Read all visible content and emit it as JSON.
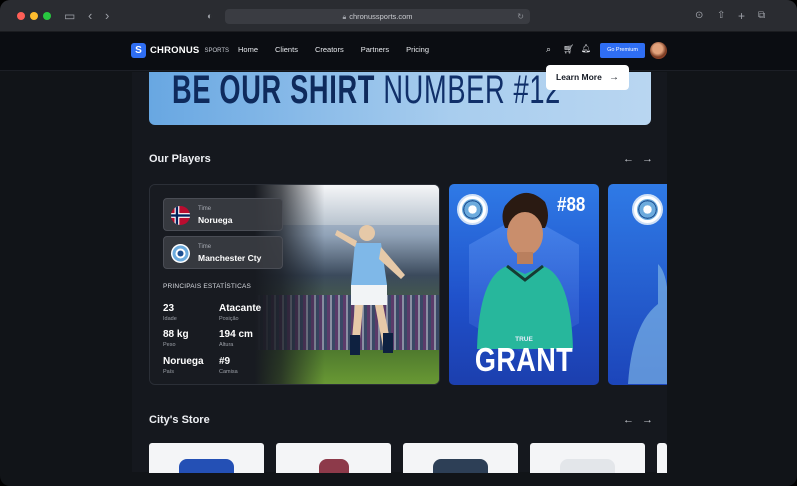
{
  "browser": {
    "url": "chronussports.com",
    "icons": [
      "sidebar-icon",
      "back-icon",
      "forward-icon",
      "shield-icon",
      "download-icon",
      "share-icon",
      "new-tab-icon",
      "tabs-icon"
    ]
  },
  "nav": {
    "logo_text": "CHRONUS",
    "logo_sub": "SPORTS",
    "links": [
      "Home",
      "Clients",
      "Creators",
      "Partners",
      "Pricing"
    ],
    "premium_label": "Go Premium"
  },
  "banner": {
    "headline_part1": "BE OUR SHIRT",
    "headline_part2": "NUMBER #12",
    "cta_label": "Learn More"
  },
  "players_section": {
    "title": "Our Players",
    "featured": {
      "country_label": "Time",
      "country": "Noruega",
      "club_label": "Time",
      "club": "Manchester Cty",
      "stats_title": "PRINCIPAIS ESTATÍSTICAS",
      "stats": [
        {
          "value": "23",
          "key": "Idade"
        },
        {
          "value": "Atacante",
          "key": "Posição"
        },
        {
          "value": "88 kg",
          "key": "Peso"
        },
        {
          "value": "194 cm",
          "key": "Altura"
        },
        {
          "value": "Noruega",
          "key": "País"
        },
        {
          "value": "#9",
          "key": "Camisa"
        }
      ]
    },
    "card2": {
      "number": "#88",
      "first_name": "TRUE",
      "last_name": "GRANT"
    }
  },
  "store_section": {
    "title": "City's Store"
  },
  "colors": {
    "accent": "#2f6ef3",
    "card_blue": "#1f4fc9",
    "background": "#15181e"
  }
}
